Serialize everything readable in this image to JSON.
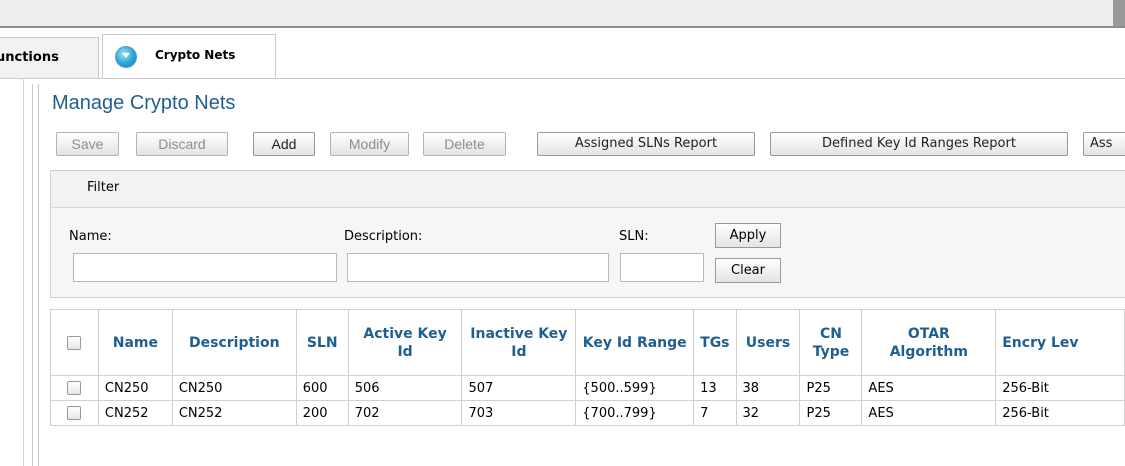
{
  "tabs": [
    {
      "label": "unctions"
    },
    {
      "label": "Crypto Nets",
      "icon": "chevron-down-circle-icon"
    }
  ],
  "page_title": "Manage Crypto Nets",
  "toolbar": {
    "save": "Save",
    "discard": "Discard",
    "add": "Add",
    "modify": "Modify",
    "delete": "Delete",
    "assigned_slns_report": "Assigned SLNs Report",
    "defined_key_id_ranges_report": "Defined Key Id Ranges Report",
    "assigned_partial": "Ass"
  },
  "filter": {
    "title": "Filter",
    "name_label": "Name:",
    "name_value": "",
    "description_label": "Description:",
    "description_value": "",
    "sln_label": "SLN:",
    "sln_value": "",
    "apply": "Apply",
    "clear": "Clear"
  },
  "table": {
    "headers": [
      "Name",
      "Description",
      "SLN",
      "Active Key Id",
      "Inactive Key Id",
      "Key Id Range",
      "TGs",
      "Users",
      "CN Type",
      "OTAR Algorithm",
      "Encry Lev"
    ],
    "rows": [
      [
        "CN250",
        "CN250",
        "600",
        "506",
        "507",
        "{500..599}",
        "13",
        "38",
        "P25",
        "AES",
        "256-Bit"
      ],
      [
        "CN252",
        "CN252",
        "200",
        "702",
        "703",
        "{700..799}",
        "7",
        "32",
        "P25",
        "AES",
        "256-Bit"
      ]
    ]
  }
}
